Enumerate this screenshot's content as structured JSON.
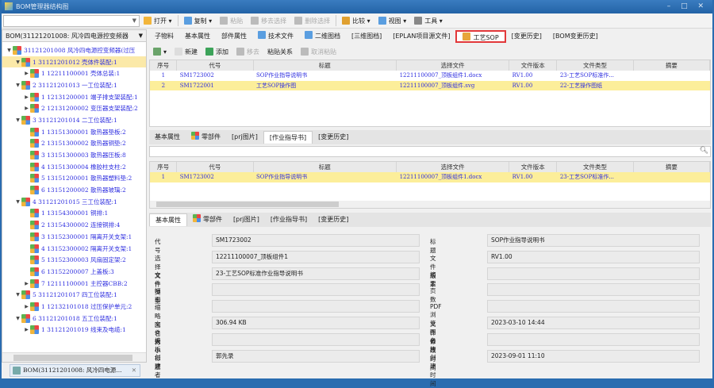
{
  "window": {
    "title": "BOM管理器结构图",
    "controls": "– □ ✕"
  },
  "toolbar": {
    "combo_value": "",
    "items": [
      {
        "label": "打开 ▾",
        "icon": "folder-icon",
        "enabled": true
      },
      {
        "label": "复制 ▾",
        "icon": "copy-icon",
        "enabled": true
      },
      {
        "label": "粘贴",
        "icon": "paste-icon",
        "enabled": false
      },
      {
        "label": "移去选择",
        "icon": "remove-icon",
        "enabled": false
      },
      {
        "label": "删除选择",
        "icon": "delete-icon",
        "enabled": false
      },
      {
        "label": "比较 ▾",
        "icon": "compare-icon",
        "enabled": true
      },
      {
        "label": "视图 ▾",
        "icon": "view-icon",
        "enabled": true
      },
      {
        "label": "工具 ▾",
        "icon": "tools-icon",
        "enabled": true
      }
    ]
  },
  "left": {
    "selector": "BOM(31121201008: 风冷四电源控变频器",
    "tree": [
      {
        "level": 0,
        "exp": "▼",
        "text": "31121201008 风冷四电源控变频器(过压"
      },
      {
        "level": 1,
        "exp": "▼",
        "text": "1  31121201012 壳体件装配:1",
        "hl": true
      },
      {
        "level": 2,
        "exp": "▶",
        "text": "1  12211100001 壳体总装:1"
      },
      {
        "level": 1,
        "exp": "▼",
        "text": "2  31121201013 一工位装配:1"
      },
      {
        "level": 2,
        "exp": "▶",
        "text": "1  12131200001 端子排支架装配:1"
      },
      {
        "level": 2,
        "exp": "▶",
        "text": "2  12131200002 变压器支架装配:2"
      },
      {
        "level": 1,
        "exp": "▼",
        "text": "3  31121201014 二工位装配:1"
      },
      {
        "level": 2,
        "exp": "",
        "text": "1  13151300001 散热器垫板:2"
      },
      {
        "level": 2,
        "exp": "",
        "text": "2  13151300002 散热器铜垫:2"
      },
      {
        "level": 2,
        "exp": "",
        "text": "3  13151300003 散热器压板:8"
      },
      {
        "level": 2,
        "exp": "",
        "text": "4  13151300004 橡胶柱支柱:2"
      },
      {
        "level": 2,
        "exp": "",
        "text": "5  13151200001 散热器塑料垫:2"
      },
      {
        "level": 2,
        "exp": "",
        "text": "6  13151200002 散热器玻璃:2"
      },
      {
        "level": 1,
        "exp": "▼",
        "text": "4  31121201015 三工位装配:1"
      },
      {
        "level": 2,
        "exp": "",
        "text": "1  13154300001 铜排:1"
      },
      {
        "level": 2,
        "exp": "",
        "text": "2  13154300002 连接铜排:4"
      },
      {
        "level": 2,
        "exp": "",
        "text": "3  13152300001 隔离开关支架:1"
      },
      {
        "level": 2,
        "exp": "",
        "text": "4  13152300002 隔离开关支架:1"
      },
      {
        "level": 2,
        "exp": "",
        "text": "5  13152300003 风扇固定架:2"
      },
      {
        "level": 2,
        "exp": "",
        "text": "6  13152200007 上盖板:3"
      },
      {
        "level": 2,
        "exp": "▶",
        "text": "7  12111100001 主控器CBB:2"
      },
      {
        "level": 1,
        "exp": "▼",
        "text": "5  31121201017 四工位装配:1"
      },
      {
        "level": 2,
        "exp": "▶",
        "text": "1  12132101018 过压保护单元:2"
      },
      {
        "level": 1,
        "exp": "▼",
        "text": "6  31121201018 五工位装配:1"
      },
      {
        "level": 2,
        "exp": "▶",
        "text": "1  31121201019 线束及电缆:1"
      }
    ]
  },
  "bottom_tab": {
    "label": "BOM(31121201008: 风冷四电源...",
    "close": "✕"
  },
  "main_tabs": [
    "子物料",
    "基本属性",
    "部件属性",
    "技术文件",
    "二维图档",
    "[三维图档]",
    "[EPLAN项目源文件]",
    "工艺SOP",
    "[变更历史]",
    "[BOM变更历史]"
  ],
  "main_tab_active": "工艺SOP",
  "sop_toolbar": [
    "新建",
    "添加",
    "移去",
    "粘贴关系",
    "取消粘贴"
  ],
  "columns": [
    "序号",
    "代号",
    "标题",
    "选择文件",
    "文件版本",
    "文件类型",
    "摘要"
  ],
  "sop_rows": [
    [
      "1",
      "SM1723002",
      "SOP作业指导说明书",
      "12211100007_顶板组件1.docx",
      "RV1.00",
      "23-工艺SOP标准作...",
      ""
    ],
    [
      "2",
      "SM1722001",
      "工艺SOP操作图",
      "12211100007_顶板组件.svg",
      "RV1.00",
      "22-工艺操作图纸",
      ""
    ]
  ],
  "sub_tabs": [
    "基本属性",
    "零部件",
    "[prj图片]",
    "[作业指导书]",
    "[变更历史]"
  ],
  "sub_tab_active": "[作业指导书]",
  "search": {
    "value": "",
    "icon": "search-icon"
  },
  "doc_rows": [
    [
      "1",
      "SM1723002",
      "SOP作业指导说明书",
      "12211100007_顶板组件1.docx",
      "RV1.00",
      "23-工艺SOP标准作...",
      ""
    ]
  ],
  "detail_tabs": [
    "基本属性",
    "零部件",
    "[prj图片]",
    "[作业指导书]",
    "[变更历史]"
  ],
  "detail_tab_active": "基本属性",
  "form": {
    "left": [
      [
        "代号",
        "SM1723002"
      ],
      [
        "选择文件",
        "12211100007_顶板组件1"
      ],
      [
        "文件类型",
        "23-工艺SOP标准作业指导说明书"
      ],
      [
        "幅面",
        ""
      ],
      [
        "缩略图名称",
        ""
      ],
      [
        "文件大小",
        "306.94 KB"
      ],
      [
        "模板标题",
        ""
      ],
      [
        "创建者",
        "郭先录"
      ]
    ],
    "right": [
      [
        "标题",
        "SOP作业指导说明书"
      ],
      [
        "文件版本",
        "RV1.00"
      ],
      [
        "摘要",
        ""
      ],
      [
        "页数",
        ""
      ],
      [
        "PDF浏览图名称",
        ""
      ],
      [
        "文件修改时间",
        "2023-03-10 14:44"
      ],
      [
        "备注",
        ""
      ],
      [
        "创建时间",
        "2023-09-01 11:10"
      ]
    ]
  },
  "colors": {
    "title": "#2363a6",
    "highlight": "#fcee9a",
    "link": "#2e2ee0",
    "tab_box": "#e2383a"
  }
}
